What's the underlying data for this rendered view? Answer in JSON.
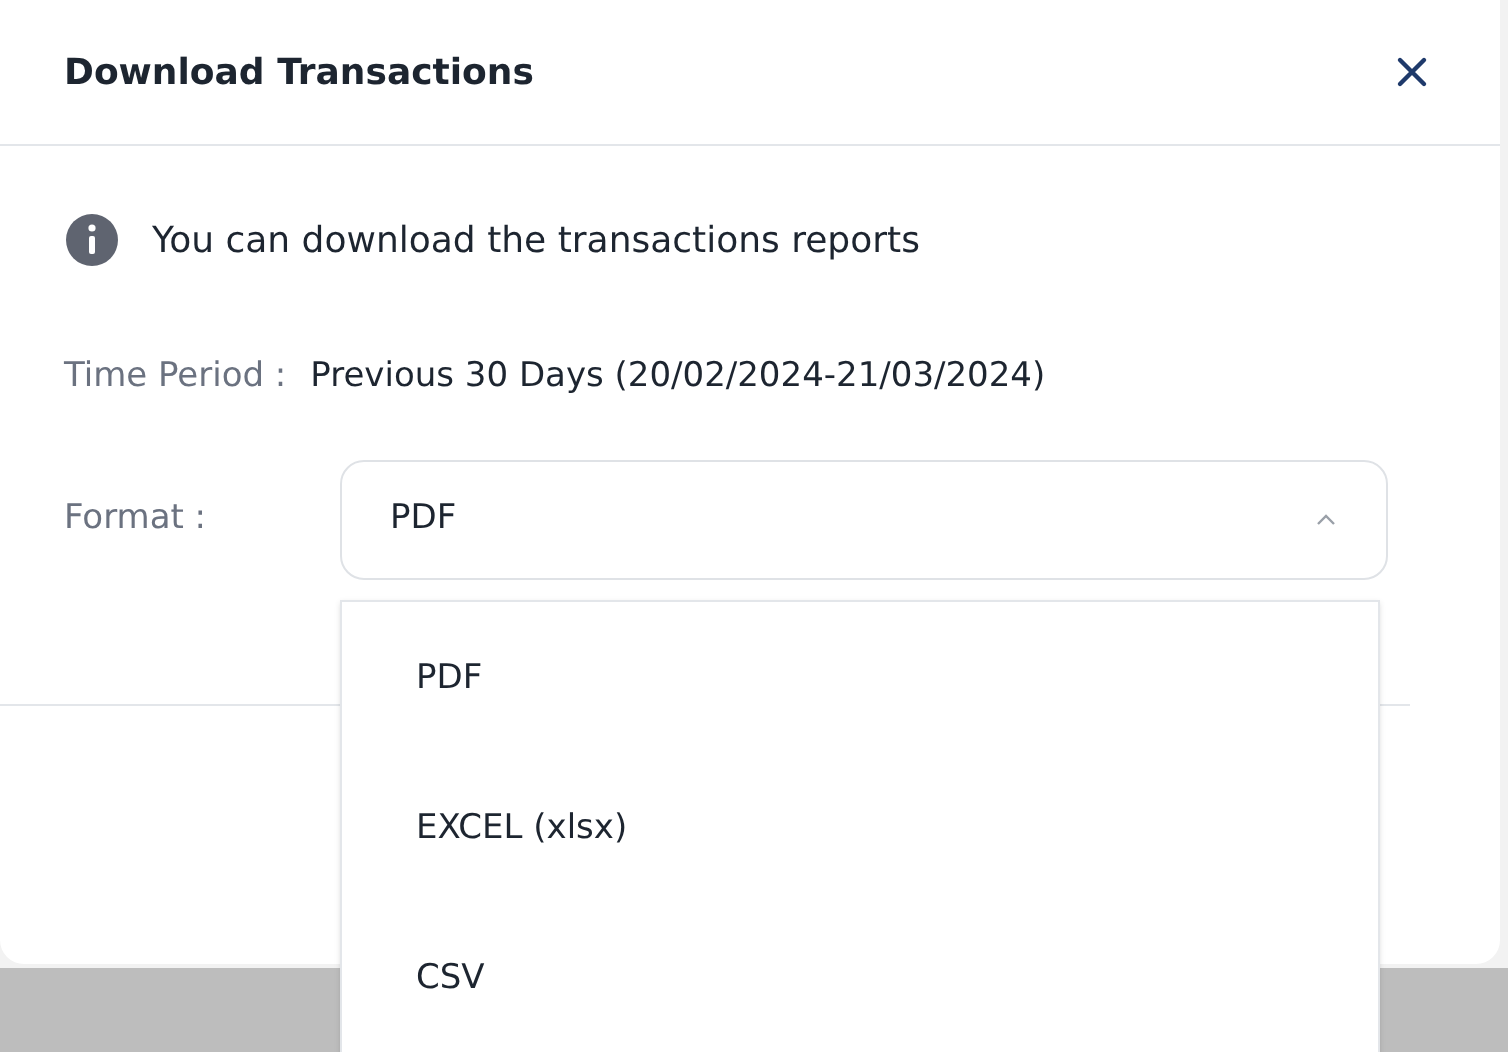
{
  "dialog": {
    "title": "Download Transactions",
    "info": "You can download the transactions reports",
    "time_period": {
      "label": "Time Period :",
      "value": "Previous 30 Days (20/02/2024-21/03/2024)"
    },
    "format": {
      "label": "Format :",
      "value": "PDF",
      "expanded": true,
      "options": [
        {
          "label": "PDF"
        },
        {
          "label": "EXCEL (xlsx)"
        },
        {
          "label": "CSV"
        }
      ]
    }
  }
}
